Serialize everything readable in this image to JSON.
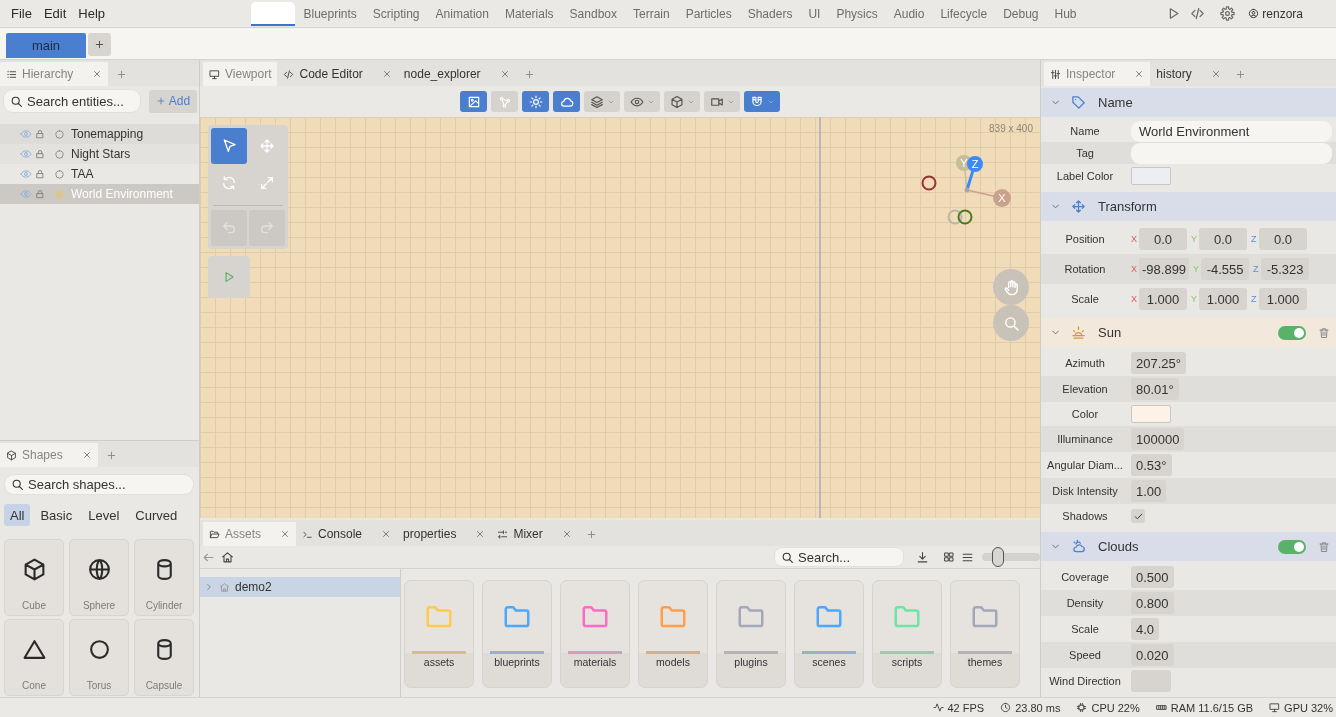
{
  "menu_bar": {
    "menus": [
      "File",
      "Edit",
      "Help"
    ],
    "workspaces": [
      {
        "selected": true
      },
      {
        "label": "Blueprints",
        "selected": false
      },
      {
        "label": "Scripting",
        "selected": false
      },
      {
        "label": "Animation",
        "selected": false
      },
      {
        "label": "Materials",
        "selected": false
      },
      {
        "label": "Sandbox",
        "selected": false
      },
      {
        "label": "Terrain",
        "selected": false
      },
      {
        "label": "Particles",
        "selected": false
      },
      {
        "label": "Shaders",
        "selected": false
      },
      {
        "label": "UI",
        "selected": false
      },
      {
        "label": "Physics",
        "selected": false
      },
      {
        "label": "Audio",
        "selected": false
      },
      {
        "label": "Lifecycle",
        "selected": false
      },
      {
        "label": "Debug",
        "selected": false
      },
      {
        "label": "Hub",
        "selected": false
      }
    ],
    "user": "renzora"
  },
  "document_tabs": [
    {
      "label": "main",
      "selected": true
    }
  ],
  "hierarchy": {
    "tabs": [
      {
        "label": "Hierarchy",
        "kind": "hierarchy",
        "selected": true,
        "closable": true
      }
    ],
    "search": {
      "placeholder": "Search entities..."
    },
    "add_button": "Add",
    "entities": [
      {
        "name": "Tonemapping",
        "kind": "effect",
        "selected": false
      },
      {
        "name": "Night Stars",
        "kind": "effect",
        "selected": false
      },
      {
        "name": "TAA",
        "kind": "effect",
        "selected": false
      },
      {
        "name": "World Environment",
        "kind": "environment",
        "selected": true
      }
    ]
  },
  "shapes": {
    "tabs": [
      {
        "label": "Shapes",
        "kind": "shapes",
        "selected": true,
        "closable": true
      }
    ],
    "search": {
      "placeholder": "Search shapes..."
    },
    "filters": [
      {
        "label": "All",
        "selected": true
      },
      {
        "label": "Basic",
        "selected": false
      },
      {
        "label": "Level",
        "selected": false
      },
      {
        "label": "Curved",
        "selected": false
      }
    ],
    "items": [
      {
        "name": "Cube",
        "kind": "cube"
      },
      {
        "name": "Sphere",
        "kind": "sphere"
      },
      {
        "name": "Cylinder",
        "kind": "cylinder"
      },
      {
        "name": "Cone",
        "kind": "cone"
      },
      {
        "name": "Torus",
        "kind": "torus"
      },
      {
        "name": "Capsule",
        "kind": "capsule"
      }
    ]
  },
  "viewport": {
    "tabs": [
      {
        "label": "Viewport",
        "kind": "viewport",
        "selected": true,
        "closable": false
      },
      {
        "label": "Code Editor",
        "kind": "editor",
        "selected": false,
        "closable": true
      },
      {
        "label": "node_explorer",
        "kind": "document",
        "selected": false,
        "closable": true
      }
    ],
    "toolbar": [
      {
        "kind": "image",
        "on": true
      },
      {
        "kind": "nodes",
        "on": false
      },
      {
        "kind": "sun",
        "on": true
      },
      {
        "kind": "cloud",
        "on": true
      },
      {
        "kind": "layers",
        "on": false
      },
      {
        "kind": "visibility",
        "on": false
      },
      {
        "kind": "shading",
        "on": false
      },
      {
        "kind": "camera",
        "on": false
      },
      {
        "kind": "snap",
        "on": true
      }
    ],
    "resolution": "839 x 400",
    "tools": [
      {
        "kind": "select",
        "selected": true
      },
      {
        "kind": "move",
        "selected": false
      },
      {
        "kind": "rotate",
        "selected": false
      },
      {
        "kind": "scale",
        "selected": false
      }
    ],
    "history": [
      {
        "kind": "undo",
        "disabled": true
      },
      {
        "kind": "redo",
        "disabled": true
      }
    ],
    "gizmo": [
      {
        "label": "Y",
        "color": "#c5bf98"
      },
      {
        "label": "Z",
        "color": "#3d8af7"
      },
      {
        "label": "X",
        "color": "#c9a28e"
      }
    ]
  },
  "assets": {
    "tabs": [
      {
        "label": "Assets",
        "kind": "assets",
        "selected": true,
        "closable": true
      },
      {
        "label": "Console",
        "kind": "console",
        "selected": false,
        "closable": true
      },
      {
        "label": "properties",
        "kind": "document",
        "selected": false,
        "closable": true
      },
      {
        "label": "Mixer",
        "kind": "mixer",
        "selected": false,
        "closable": true
      }
    ],
    "search": {
      "placeholder": "Search..."
    },
    "zoom_slider": {
      "level": 0.2
    },
    "tree": [
      {
        "name": "demo2",
        "selected": true,
        "expanded": false
      }
    ],
    "folders": [
      {
        "name": "assets",
        "color": "#ffc94d"
      },
      {
        "name": "blueprints",
        "color": "#4aa8ff"
      },
      {
        "name": "materials",
        "color": "#ff69c8"
      },
      {
        "name": "models",
        "color": "#ff9f4a"
      },
      {
        "name": "plugins",
        "color": "#a3a7b8"
      },
      {
        "name": "scenes",
        "color": "#4aa8ff"
      },
      {
        "name": "scripts",
        "color": "#6fe3a6"
      },
      {
        "name": "themes",
        "color": "#a3a7b8"
      }
    ]
  },
  "inspector": {
    "tabs": [
      {
        "label": "Inspector",
        "kind": "inspector",
        "selected": true,
        "closable": true
      },
      {
        "label": "history",
        "kind": "document",
        "selected": false,
        "closable": true
      }
    ],
    "sections": [
      {
        "title": "Name",
        "kind": "name",
        "expanded": true,
        "fields": [
          {
            "label": "Name",
            "kind": "text",
            "value": "World Environment"
          },
          {
            "label": "Tag",
            "kind": "text"
          },
          {
            "label": "Label Color",
            "kind": "color",
            "color": "#eceef4"
          }
        ]
      },
      {
        "title": "Transform",
        "kind": "transform",
        "expanded": true,
        "fields": [
          {
            "label": "Position",
            "kind": "vector",
            "values": [
              {
                "axis": "X",
                "value": "0.0"
              },
              {
                "axis": "Y",
                "value": "0.0"
              },
              {
                "axis": "Z",
                "value": "0.0"
              }
            ]
          },
          {
            "label": "Rotation",
            "kind": "vector",
            "values": [
              {
                "axis": "X",
                "value": "-98.899"
              },
              {
                "axis": "Y",
                "value": "-4.555"
              },
              {
                "axis": "Z",
                "value": "-5.323"
              }
            ]
          },
          {
            "label": "Scale",
            "kind": "vector",
            "values": [
              {
                "axis": "X",
                "value": "1.000"
              },
              {
                "axis": "Y",
                "value": "1.000"
              },
              {
                "axis": "Z",
                "value": "1.000"
              }
            ]
          }
        ]
      },
      {
        "title": "Sun",
        "kind": "sun",
        "expanded": true,
        "enabled": true,
        "fields": [
          {
            "label": "Azimuth",
            "kind": "number",
            "value": "207.25°"
          },
          {
            "label": "Elevation",
            "kind": "number",
            "value": "80.01°"
          },
          {
            "label": "Color",
            "kind": "color",
            "color": "#fdf2e6"
          },
          {
            "label": "Illuminance",
            "kind": "number",
            "value": "100000"
          },
          {
            "label": "Angular Diam...",
            "kind": "number",
            "value": "0.53°"
          },
          {
            "label": "Disk Intensity",
            "kind": "number",
            "value": "1.00"
          },
          {
            "label": "Shadows",
            "kind": "checkbox",
            "checked": true
          }
        ]
      },
      {
        "title": "Clouds",
        "kind": "clouds",
        "expanded": true,
        "enabled": true,
        "fields": [
          {
            "label": "Coverage",
            "kind": "number",
            "value": "0.500"
          },
          {
            "label": "Density",
            "kind": "number",
            "value": "0.800"
          },
          {
            "label": "Scale",
            "kind": "number",
            "value": "4.0"
          },
          {
            "label": "Speed",
            "kind": "number",
            "value": "0.020"
          },
          {
            "label": "Wind Direction",
            "kind": "number"
          }
        ]
      }
    ]
  },
  "status_bar": [
    {
      "kind": "fps",
      "text": "42 FPS"
    },
    {
      "kind": "frame",
      "text": "23.80 ms"
    },
    {
      "kind": "cpu",
      "text": "CPU 22%"
    },
    {
      "kind": "ram",
      "text": "RAM 11.6/15 GB"
    },
    {
      "kind": "gpu",
      "text": "GPU 32%"
    }
  ]
}
